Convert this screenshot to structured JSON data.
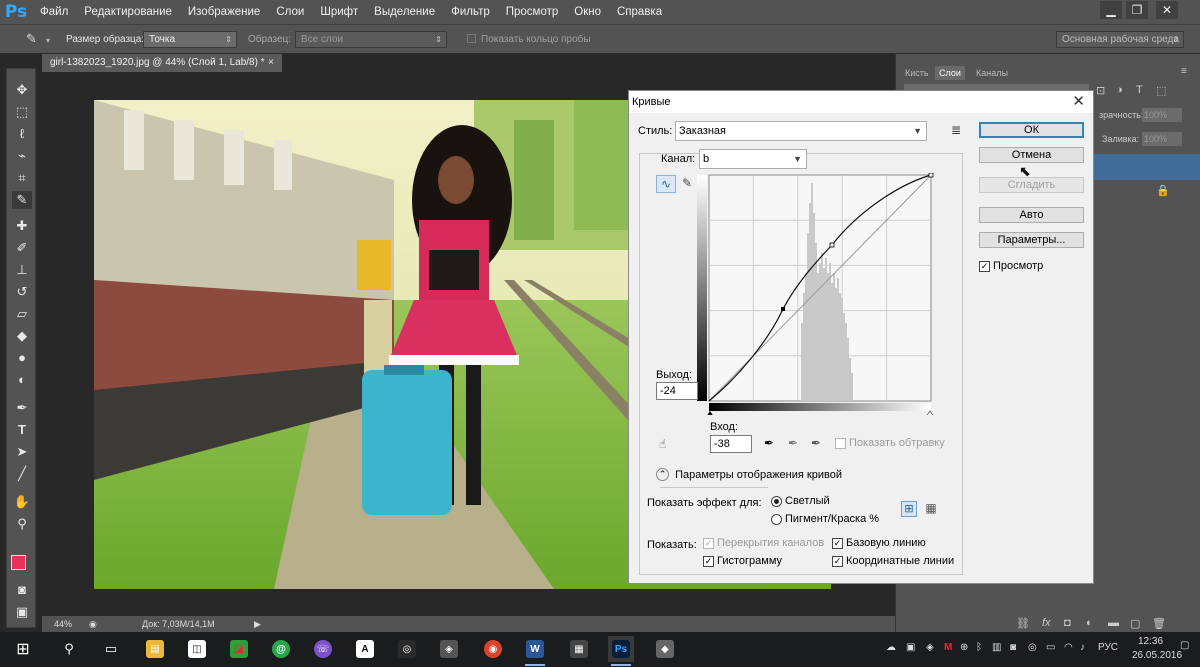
{
  "app": {
    "logo": "Ps"
  },
  "menu": [
    "Файл",
    "Редактирование",
    "Изображение",
    "Слои",
    "Шрифт",
    "Выделение",
    "Фильтр",
    "Просмотр",
    "Окно",
    "Справка"
  ],
  "options": {
    "sample_size_label": "Размер образца:",
    "sample_size_value": "Точка",
    "sample_label": "Образец:",
    "sample_value": "Все слои",
    "sample_ring_label": "Показать кольцо пробы",
    "workspace": "Основная рабочая среда"
  },
  "document": {
    "tab_title": "girl-1382023_1920.jpg @ 44% (Слой 1, Lab/8) *",
    "zoom": "44%",
    "doc_size": "Док: 7,03M/14,1M"
  },
  "panels": {
    "tabs": [
      "Кисть",
      "Слои",
      "Каналы"
    ],
    "opacity_label": "зрачность:",
    "opacity_value": "100%",
    "fill_label": "Заливка:",
    "fill_value": "100%"
  },
  "dialog": {
    "title": "Кривые",
    "style_label": "Стиль:",
    "style_value": "Заказная",
    "channel_label": "Канал:",
    "channel_value": "b",
    "output_label": "Выход:",
    "output_value": "-24",
    "input_label": "Вход:",
    "input_value": "-38",
    "show_clipping": "Показать обтравку",
    "curve_display_options": "Параметры отображения кривой",
    "show_amount_label": "Показать эффект для:",
    "light_option": "Светлый",
    "pigment_option": "Пигмент/Краска %",
    "show_label": "Показать:",
    "channel_overlays": "Перекрытия каналов",
    "baseline": "Базовую линию",
    "histogram": "Гистограмму",
    "intersection_line": "Координатные линии",
    "buttons": {
      "ok": "ОК",
      "cancel": "Отмена",
      "smooth": "Сгладить",
      "auto": "Авто",
      "options": "Параметры..."
    },
    "preview_label": "Просмотр",
    "preview_checked": true
  },
  "taskbar": {
    "time": "12:36",
    "date": "26.05.2016",
    "lang": "РУС"
  },
  "colors": {
    "foreground": "#e8325a",
    "background": "#000000",
    "accent": "#31a8ff"
  }
}
